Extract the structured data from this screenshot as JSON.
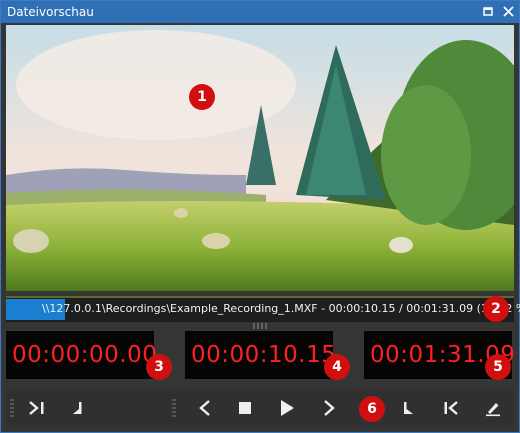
{
  "window": {
    "title": "Dateivorschau",
    "title_bar_color": "#2f6fb5",
    "icons": [
      "restore-icon",
      "close-icon"
    ]
  },
  "preview": {
    "scene": [
      "sky",
      "pine-trees",
      "grass-meadow"
    ]
  },
  "progress": {
    "text": "\\\\127.0.0.1\\Recordings\\Example_Recording_1.MXF - 00:00:10.15 / 00:01:31.09 (11,62 %)",
    "percent": 11.62,
    "fill_color": "#1b7fd1"
  },
  "timecodes": {
    "in": "00:00:00.00",
    "current": "00:00:10.15",
    "out": "00:01:31.09",
    "color": "#ff2020"
  },
  "controls": {
    "icons": [
      "go-to-start-icon",
      "mark-in-icon",
      "previous-frame-icon",
      "stop-icon",
      "play-icon",
      "next-frame-icon",
      "mark-out-icon",
      "go-to-end-icon",
      "edit-icon"
    ]
  },
  "markers": [
    "1",
    "2",
    "3",
    "4",
    "5",
    "6"
  ]
}
